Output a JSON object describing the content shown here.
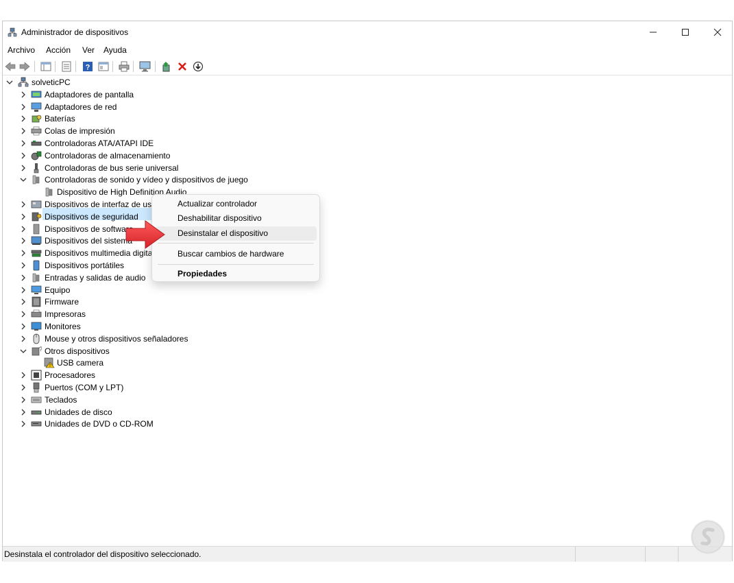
{
  "window": {
    "title": "Administrador de dispositivos"
  },
  "menu": [
    "Archivo",
    "Acción",
    "Ver",
    "Ayuda"
  ],
  "tree": {
    "root": "solveticPC",
    "items": [
      {
        "label": "Adaptadores de pantalla",
        "icon": "display-adapter-icon"
      },
      {
        "label": "Adaptadores de red",
        "icon": "network-adapter-icon"
      },
      {
        "label": "Baterías",
        "icon": "battery-icon"
      },
      {
        "label": "Colas de impresión",
        "icon": "print-queue-icon"
      },
      {
        "label": "Controladoras ATA/ATAPI IDE",
        "icon": "ide-controller-icon"
      },
      {
        "label": "Controladoras de almacenamiento",
        "icon": "storage-controller-icon"
      },
      {
        "label": "Controladoras de bus serie universal",
        "icon": "usb-controller-icon"
      },
      {
        "label": "Controladoras de sonido y vídeo y dispositivos de juego",
        "icon": "speaker-icon",
        "expanded": true
      },
      {
        "label": "Dispositivo de High Definition Audio",
        "icon": "speaker-icon",
        "child": true,
        "selected": true
      },
      {
        "label": "Dispositivos de interfaz de usuario",
        "icon": "hid-icon"
      },
      {
        "label": "Dispositivos de seguridad",
        "icon": "security-device-icon"
      },
      {
        "label": "Dispositivos de software",
        "icon": "software-device-icon"
      },
      {
        "label": "Dispositivos del sistema",
        "icon": "system-device-icon"
      },
      {
        "label": "Dispositivos multimedia digitales",
        "icon": "multimedia-device-icon"
      },
      {
        "label": "Dispositivos portátiles",
        "icon": "portable-device-icon"
      },
      {
        "label": "Entradas y salidas de audio",
        "icon": "audio-io-icon"
      },
      {
        "label": "Equipo",
        "icon": "computer-icon"
      },
      {
        "label": "Firmware",
        "icon": "firmware-icon"
      },
      {
        "label": "Impresoras",
        "icon": "printer-icon"
      },
      {
        "label": "Monitores",
        "icon": "monitor-icon"
      },
      {
        "label": "Mouse y otros dispositivos señaladores",
        "icon": "mouse-icon"
      },
      {
        "label": "Otros dispositivos",
        "icon": "other-devices-icon",
        "expanded": true
      },
      {
        "label": "USB camera",
        "icon": "warning-device-icon",
        "child": true
      },
      {
        "label": "Procesadores",
        "icon": "processor-icon"
      },
      {
        "label": "Puertos (COM y LPT)",
        "icon": "port-icon"
      },
      {
        "label": "Teclados",
        "icon": "keyboard-icon"
      },
      {
        "label": "Unidades de disco",
        "icon": "disk-drive-icon"
      },
      {
        "label": "Unidades de DVD o CD-ROM",
        "icon": "dvd-drive-icon"
      }
    ]
  },
  "context_menu": {
    "update": "Actualizar controlador",
    "disable": "Deshabilitar dispositivo",
    "uninstall": "Desinstalar el dispositivo",
    "scan": "Buscar cambios de hardware",
    "properties": "Propiedades"
  },
  "status": {
    "text": "Desinstala el controlador del dispositivo seleccionado."
  },
  "colors": {
    "selection": "#cce8ff",
    "arrow": "#e8393c",
    "hover": "#ececec"
  }
}
